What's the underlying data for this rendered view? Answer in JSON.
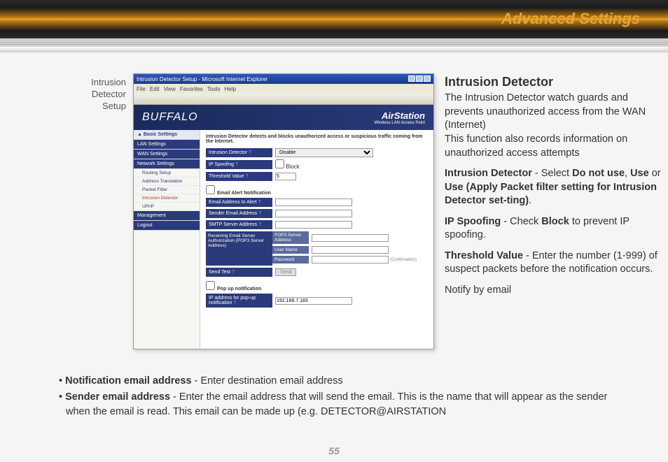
{
  "page": {
    "title": "Advanced Settings",
    "number": "55",
    "caption": "Intrusion\nDetector\nSetup"
  },
  "browser": {
    "title": "Intrusion Detector Setup - Microsoft Internet Explorer",
    "menu": [
      "File",
      "Edit",
      "View",
      "Favorites",
      "Tools",
      "Help"
    ]
  },
  "app": {
    "logo_left": "BUFFALO",
    "logo_right": "AirStation",
    "logo_sub": "Wireless LAN Access Point",
    "intro": "Intrusion Detector detects and blocks unauthorized access or suspicious traffic coming from the Internet.",
    "nav": {
      "basic": "▲ Basic Settings",
      "lan": "LAN Settings",
      "wan": "WAN Settings",
      "net": "Network Settings",
      "subs": [
        "Routing Setup",
        "Address Translation",
        "Packet Filter",
        "Intrusion Detector",
        "UPnP"
      ],
      "mgmt": "Management",
      "logout": "Logout"
    },
    "form": {
      "intrusion_detector": "Intrusion Detector",
      "intrusion_value": "Disable",
      "ip_spoofing": "IP Spoofing",
      "block": "Block",
      "threshold": "Threshold Value",
      "threshold_val": "5",
      "email_alert": "Email Alert Notification",
      "email_to": "Email Address to Alert",
      "sender": "Sender Email Address",
      "smtp": "SMTP Server Address",
      "recv_auth": "Receiving Email Server Authorization (POP3 Server Address)",
      "pop3": "POP3 Server Address",
      "user": "User Name",
      "pass": "Password",
      "confirm": "(Confirmation)",
      "send_test": "Send Test",
      "send_btn": "Send",
      "popup": "Pop up notification",
      "popup_ip": "IP address for pop-up notification",
      "popup_ip_val": "192.168.7.183"
    }
  },
  "desc": {
    "h": "Intrusion Detector",
    "p1": "The Intrusion Detector watch guards and prevents unauthorized access from the WAN (Internet)\nThis function also records information on unauthorized access attempts",
    "p2a": "Intrusion Detector",
    "p2b": " - Select ",
    "p2c": "Do not use",
    "p2d": ", ",
    "p2e": "Use",
    "p2f": " or ",
    "p2g": "Use (Apply Packet filter setting for Intrusion Detector set-ting)",
    "p2h": ".",
    "p3a": "IP Spoofing",
    "p3b": " - Check ",
    "p3c": "Block",
    "p3d": " to prevent IP spoofing.",
    "p4a": "Threshold Value",
    "p4b": " - Enter the number (1-999) of suspect packets before the notification occurs.",
    "p5": "Notify by email"
  },
  "bullets": {
    "b1a": "Notification email address",
    "b1b": " - Enter destination email address",
    "b2a": "Sender email address",
    "b2b": " - Enter the email address that will send the email.  This is the name that will appear as the sender when the email is read.  This email can be made up (e.g. DETECTOR@AIRSTATION"
  }
}
